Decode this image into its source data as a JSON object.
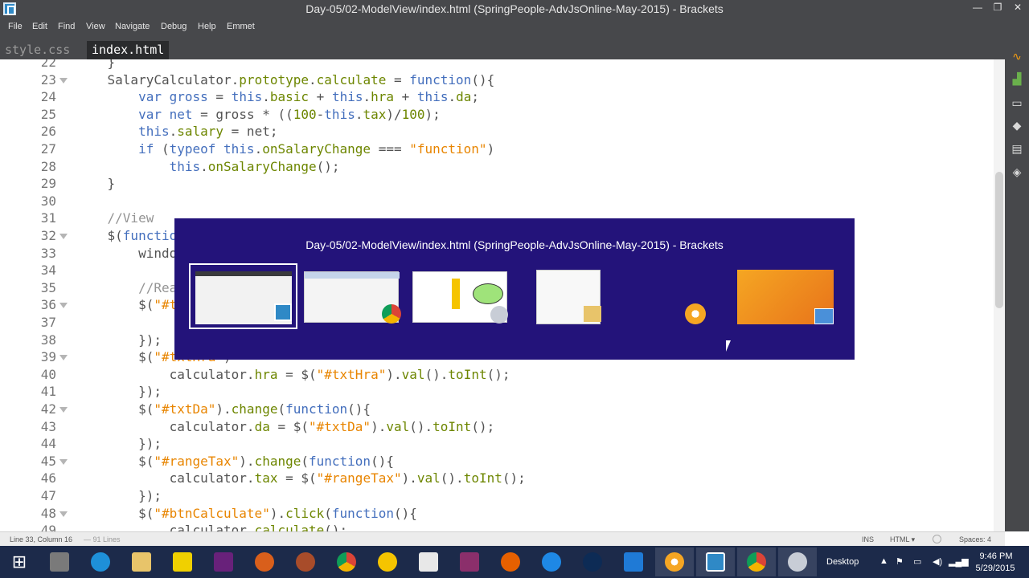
{
  "window": {
    "title": "Day-05/02-ModelView/index.html (SpringPeople-AdvJsOnline-May-2015) - Brackets",
    "minimize": "—",
    "restore": "❐",
    "close": "✕"
  },
  "menu": [
    "File",
    "Edit",
    "Find",
    "View",
    "Navigate",
    "Debug",
    "Help",
    "Emmet"
  ],
  "tabs": [
    {
      "label": "style.css",
      "active": false
    },
    {
      "label": "index.html",
      "active": true
    }
  ],
  "editor": {
    "lines": [
      {
        "n": "22",
        "fold": false,
        "html": "    }"
      },
      {
        "n": "23",
        "fold": true,
        "html": "    SalaryCalculator.<span class='prop'>prototype</span>.<span class='prop'>calculate</span> = <span class='kw'>function</span>(){"
      },
      {
        "n": "24",
        "fold": false,
        "html": "        <span class='kw'>var</span> <span class='kw'>gross</span> = <span class='kw'>this</span>.<span class='prop'>basic</span> + <span class='kw'>this</span>.<span class='prop'>hra</span> + <span class='kw'>this</span>.<span class='prop'>da</span>;"
      },
      {
        "n": "25",
        "fold": false,
        "html": "        <span class='kw'>var</span> <span class='kw'>net</span> = gross * ((<span class='num'>100</span>-<span class='kw'>this</span>.<span class='prop'>tax</span>)/<span class='num'>100</span>);"
      },
      {
        "n": "26",
        "fold": false,
        "html": "        <span class='kw'>this</span>.<span class='prop'>salary</span> = net;"
      },
      {
        "n": "27",
        "fold": false,
        "html": "        <span class='kw'>if</span> (<span class='kw'>typeof</span> <span class='kw'>this</span>.<span class='prop'>onSalaryChange</span> === <span class='str'>\"function\"</span>)"
      },
      {
        "n": "28",
        "fold": false,
        "html": "            <span class='kw'>this</span>.<span class='prop'>onSalaryChange</span>();"
      },
      {
        "n": "29",
        "fold": false,
        "html": "    }"
      },
      {
        "n": "30",
        "fold": false,
        "html": ""
      },
      {
        "n": "31",
        "fold": false,
        "html": "    <span class='cmt'>//View</span>"
      },
      {
        "n": "32",
        "fold": true,
        "html": "    $(<span class='kw'>function</span>(){"
      },
      {
        "n": "33",
        "fold": false,
        "html": "        window"
      },
      {
        "n": "34",
        "fold": false,
        "html": ""
      },
      {
        "n": "35",
        "fold": false,
        "html": "        <span class='cmt'>//Reactions</span>"
      },
      {
        "n": "36",
        "fold": true,
        "html": "        $(<span class='str'>\"#txtBasic\"</span>)"
      },
      {
        "n": "37",
        "fold": false,
        "html": ""
      },
      {
        "n": "38",
        "fold": false,
        "html": "        });"
      },
      {
        "n": "39",
        "fold": true,
        "html": "        $(<span class='str'>\"#txtHra\"</span>)"
      },
      {
        "n": "40",
        "fold": false,
        "html": "            calculator.<span class='prop'>hra</span> = $(<span class='str'>\"#txtHra\"</span>).<span class='prop'>val</span>().<span class='prop'>toInt</span>();"
      },
      {
        "n": "41",
        "fold": false,
        "html": "        });"
      },
      {
        "n": "42",
        "fold": true,
        "html": "        $(<span class='str'>\"#txtDa\"</span>).<span class='prop'>change</span>(<span class='kw'>function</span>(){"
      },
      {
        "n": "43",
        "fold": false,
        "html": "            calculator.<span class='prop'>da</span> = $(<span class='str'>\"#txtDa\"</span>).<span class='prop'>val</span>().<span class='prop'>toInt</span>();"
      },
      {
        "n": "44",
        "fold": false,
        "html": "        });"
      },
      {
        "n": "45",
        "fold": true,
        "html": "        $(<span class='str'>\"#rangeTax\"</span>).<span class='prop'>change</span>(<span class='kw'>function</span>(){"
      },
      {
        "n": "46",
        "fold": false,
        "html": "            calculator.<span class='prop'>tax</span> = $(<span class='str'>\"#rangeTax\"</span>).<span class='prop'>val</span>().<span class='prop'>toInt</span>();"
      },
      {
        "n": "47",
        "fold": false,
        "html": "        });"
      },
      {
        "n": "48",
        "fold": true,
        "html": "        $(<span class='str'>\"#btnCalculate\"</span>).<span class='prop'>click</span>(<span class='kw'>function</span>(){"
      },
      {
        "n": "49",
        "fold": false,
        "html": "            calculator.<span class='prop'>calculate</span>();"
      }
    ]
  },
  "statusbar": {
    "position": "Line 33, Column 16",
    "lines_count": "— 91 Lines",
    "mode": "INS",
    "language": "HTML ▾",
    "spaces": "Spaces: 4"
  },
  "switcher": {
    "title": "Day-05/02-ModelView/index.html (SpringPeople-AdvJsOnline-May-2015) - Brackets"
  },
  "taskbar": {
    "desktop_label": "Desktop",
    "time": "9:46 PM",
    "date": "5/29/2015"
  },
  "colors": {
    "chrome": "#47484b",
    "switcher_bg": "#23137a",
    "taskbar_bg": "#1c2a4a",
    "keyword": "#446fbd",
    "string": "#e88501",
    "number": "#6d8600"
  }
}
